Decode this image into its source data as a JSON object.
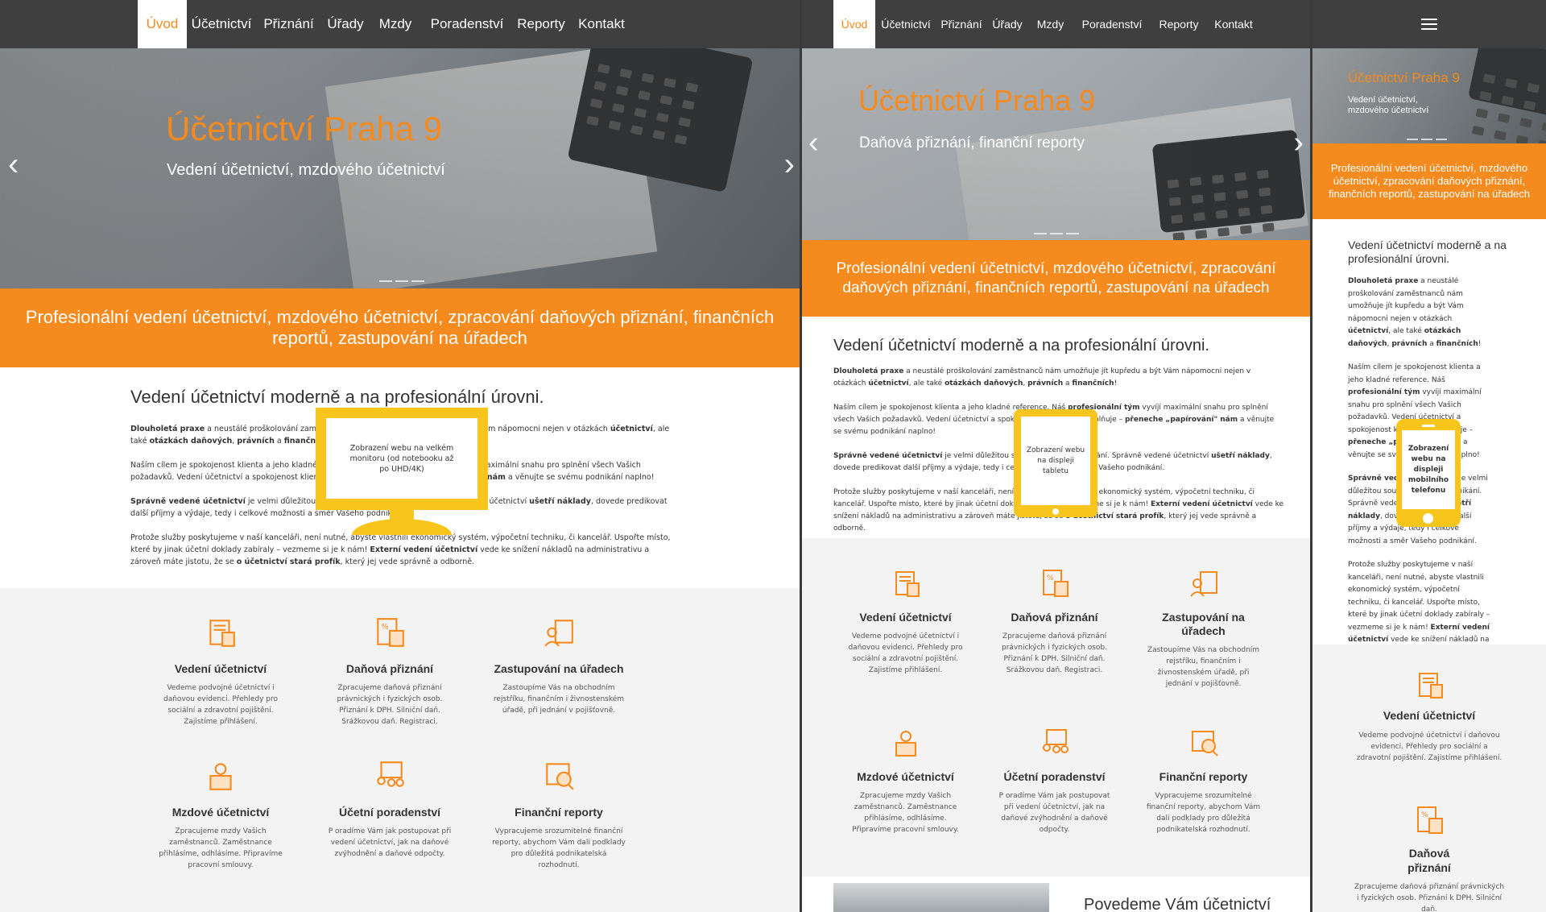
{
  "nav": [
    "Úvod",
    "Účetnictví",
    "Přiznání",
    "Úřady",
    "Mzdy",
    "Poradenství",
    "Reporty",
    "Kontakt"
  ],
  "hero_desktop": {
    "title": "Účetnictví Praha 9",
    "subtitle": "Vedení účetnictví, mzdového účetnictví"
  },
  "hero_tablet": {
    "title": "Účetnictví Praha 9",
    "subtitle": "Daňová přiznání, finanční reporty"
  },
  "hero_mobile": {
    "title": "Účetnictví Praha 9",
    "subtitle": "Vedení účetnictví, mzdového účetnictví"
  },
  "band": "Profesionální vedení účetnictví, mzdového účetnictví, zpracování daňových přiznání, finančních reportů, zastupování na úřadech",
  "intro_title": "Vedení účetnictví moderně a na profesionální úrovni.",
  "p1": {
    "b1": "Dlouholetá praxe",
    "t1": " a neustálé proškolování zaměstnanců nám umožňuje jít kupředu a být Vám nápomocni nejen v otázkách ",
    "b2": "účetnictví",
    "t2": ", ale také ",
    "b3": "otázkách daňových",
    "t3": ", ",
    "b4": "právních",
    "t4": " a ",
    "b5": "finančních",
    "t5": "!"
  },
  "p2": {
    "t1": "Naším cílem je spokojenost klienta a jeho kladné reference. Náš ",
    "b1": "profesionální tým",
    "t2": " vyvíjí maximální snahu pro splnění všech Vašich požadavků. Vedení účetnictví a spokojenost klientů nás naplňuje – ",
    "b2": "přeneche „papírování\" nám",
    "t3": " a věnujte se svému podnikání naplno!"
  },
  "p3": {
    "b1": "Správně vedené účetnictví",
    "t1": " je velmi důležitou součástí Vašeho podnikání. Správně vedené účetnictví ",
    "b2": "ušetří náklady",
    "t2": ", dovede predikovat další příjmy a výdaje, tedy i celkové možnosti a směr Vašeho podnikání."
  },
  "p4": {
    "t1": "Protože služby poskytujeme v naší kanceláři, není nutné, abyste vlastnili ekonomický systém, výpočetní techniku, či kancelář. Uspořte místo, které by jinak účetní doklady zabíraly – vezmeme si je k nám! ",
    "b1": "Externí vedení účetnictví",
    "t2": " vede ke snížení nákladů na administrativu a zároveň máte jistotu, že se ",
    "b2": "o účetnictví stará profík",
    "t3": ", který jej vede správně a odborně."
  },
  "services": [
    {
      "icon": "accounting-icon",
      "title": "Vedení účetnictví",
      "desc": "Vedeme podvojné účetnictví i daňovou evidenci. Přehledy pro sociální a zdravotní pojištění. Zajistíme přihlášení."
    },
    {
      "icon": "tax-icon",
      "title": "Daňová přiznání",
      "desc": "Zpracujeme daňová přiznání právnických i fyzických osob. Přiznání k DPH. Silniční daň. Srážkovou daň. Registraci."
    },
    {
      "icon": "office-icon",
      "title": "Zastupování na úřadech",
      "desc": "Zastoupíme Vás na obchodním rejstříku, finančním i živnostenském úřadě, při jednání v pojišťovně."
    },
    {
      "icon": "payroll-icon",
      "title": "Mzdové účetnictví",
      "desc": "Zpracujeme mzdy Vašich zaměstnanců. Zaměstnance přihlásíme, odhlásíme. Připravíme pracovní smlouvy."
    },
    {
      "icon": "consulting-icon",
      "title": "Účetní poradenství",
      "desc": "P oradíme Vám jak postupovat při vedení účetnictví, jak na daňové zvýhodnění a daňové odpočty."
    },
    {
      "icon": "report-icon",
      "title": "Finanční reporty",
      "desc": "Vypracujeme srozumitelné finanční reporty, abychom Vám dali podklady pro důležitá podnikatelská rozhodnutí."
    }
  ],
  "mobile_services": [
    {
      "title": "Vedení účetnictví",
      "desc": "Vedeme podvojné účetnictví i daňovou evidenci. Přehledy pro sociální a zdravotní pojištění. Zajistíme přihlášení."
    },
    {
      "title": "Daňová přiznání",
      "desc": "Zpracujeme daňová přiznání právnických i fyzických osob. Přiznání k DPH. Silniční daň."
    }
  ],
  "tablet_bottom": "Povedeme Vám účetnictví",
  "labels": {
    "monitor": "Zobrazení webu na velkém monitoru (od notebooku až po UHD/4K)",
    "tablet": "Zobrazení webu na displeji tabletu",
    "phone": "Zobrazení webu na displeji mobilního telefonu"
  },
  "colors": {
    "accent": "#f58a1f",
    "nav": "#3f3f3f",
    "grey": "#f3f3f3",
    "yellow": "#f7c51b"
  }
}
